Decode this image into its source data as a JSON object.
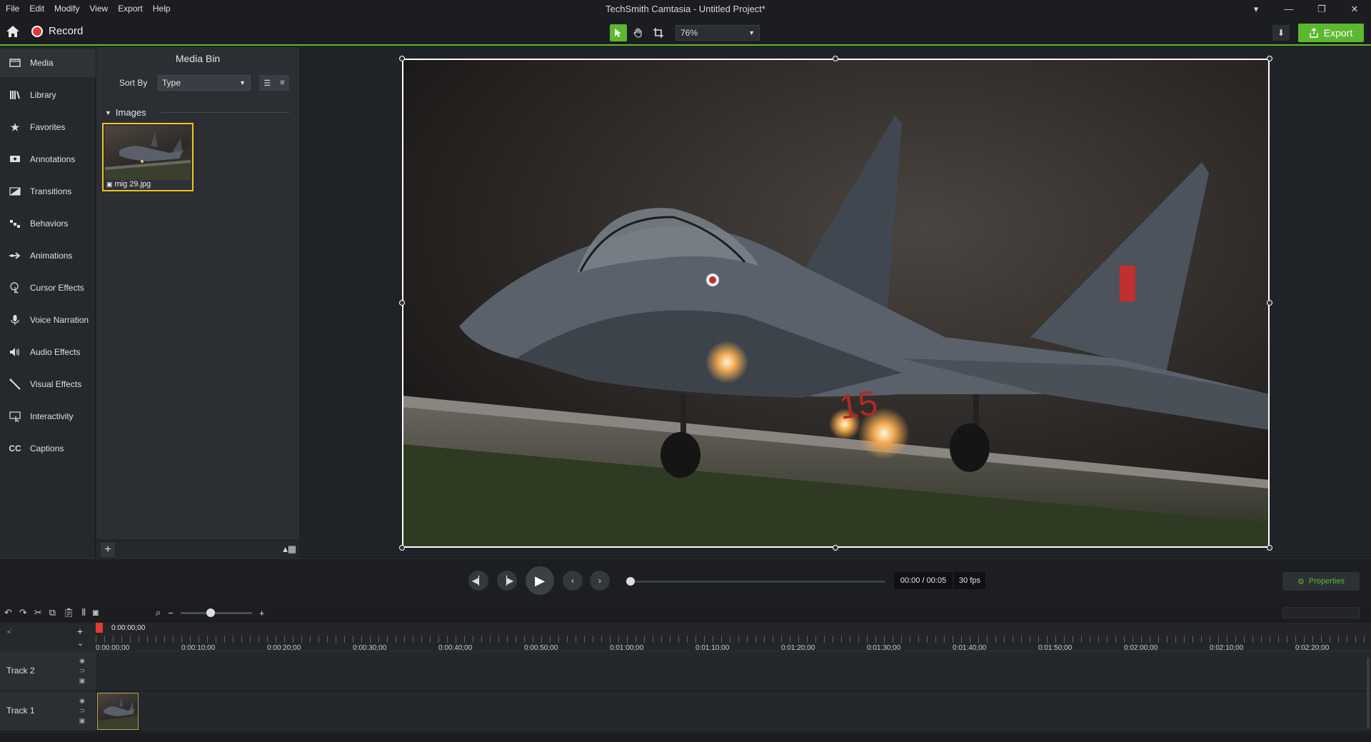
{
  "menu": [
    "File",
    "Edit",
    "Modify",
    "View",
    "Export",
    "Help"
  ],
  "app_title": "TechSmith Camtasia - Untitled Project*",
  "window_controls": {
    "dropdown": "▾",
    "minimize": "—",
    "restore": "❐",
    "close": "✕"
  },
  "toolbar": {
    "record_label": "Record",
    "zoom_value": "76%",
    "export_label": "Export"
  },
  "sidebar": {
    "items": [
      {
        "label": "Media",
        "icon": "media-icon"
      },
      {
        "label": "Library",
        "icon": "library-icon"
      },
      {
        "label": "Favorites",
        "icon": "star-icon"
      },
      {
        "label": "Annotations",
        "icon": "annotation-icon"
      },
      {
        "label": "Transitions",
        "icon": "transition-icon"
      },
      {
        "label": "Behaviors",
        "icon": "behaviors-icon"
      },
      {
        "label": "Animations",
        "icon": "animation-icon"
      },
      {
        "label": "Cursor Effects",
        "icon": "cursor-icon"
      },
      {
        "label": "Voice Narration",
        "icon": "microphone-icon"
      },
      {
        "label": "Audio Effects",
        "icon": "speaker-icon"
      },
      {
        "label": "Visual Effects",
        "icon": "wand-icon"
      },
      {
        "label": "Interactivity",
        "icon": "interactivity-icon"
      },
      {
        "label": "Captions",
        "icon": "captions-icon"
      }
    ]
  },
  "media_bin": {
    "title": "Media Bin",
    "sort_by_label": "Sort By",
    "sort_by_value": "Type",
    "group_label": "Images",
    "items": [
      {
        "name": "mig 29.jpg"
      }
    ]
  },
  "playback": {
    "time": "00:00 / 00:05",
    "fps": "30 fps",
    "progress": 0,
    "properties_label": "Properties"
  },
  "timeline": {
    "playhead_time": "0:00:00;00",
    "zoom_level": 0.42,
    "ticks": [
      "0:00:00;00",
      "0:00:10;00",
      "0:00:20;00",
      "0:00:30;00",
      "0:00:40;00",
      "0:00:50;00",
      "0:01:00;00",
      "0:01:10;00",
      "0:01:20;00",
      "0:01:30;00",
      "0:01:40;00",
      "0:01:50;00",
      "0:02:00;00",
      "0:02:10;00",
      "0:02:20;00"
    ],
    "tracks": [
      {
        "name": "Track 2"
      },
      {
        "name": "Track 1"
      }
    ]
  },
  "colors": {
    "accent": "#5cb82f",
    "record": "#e53935",
    "selection": "#f0c419"
  }
}
